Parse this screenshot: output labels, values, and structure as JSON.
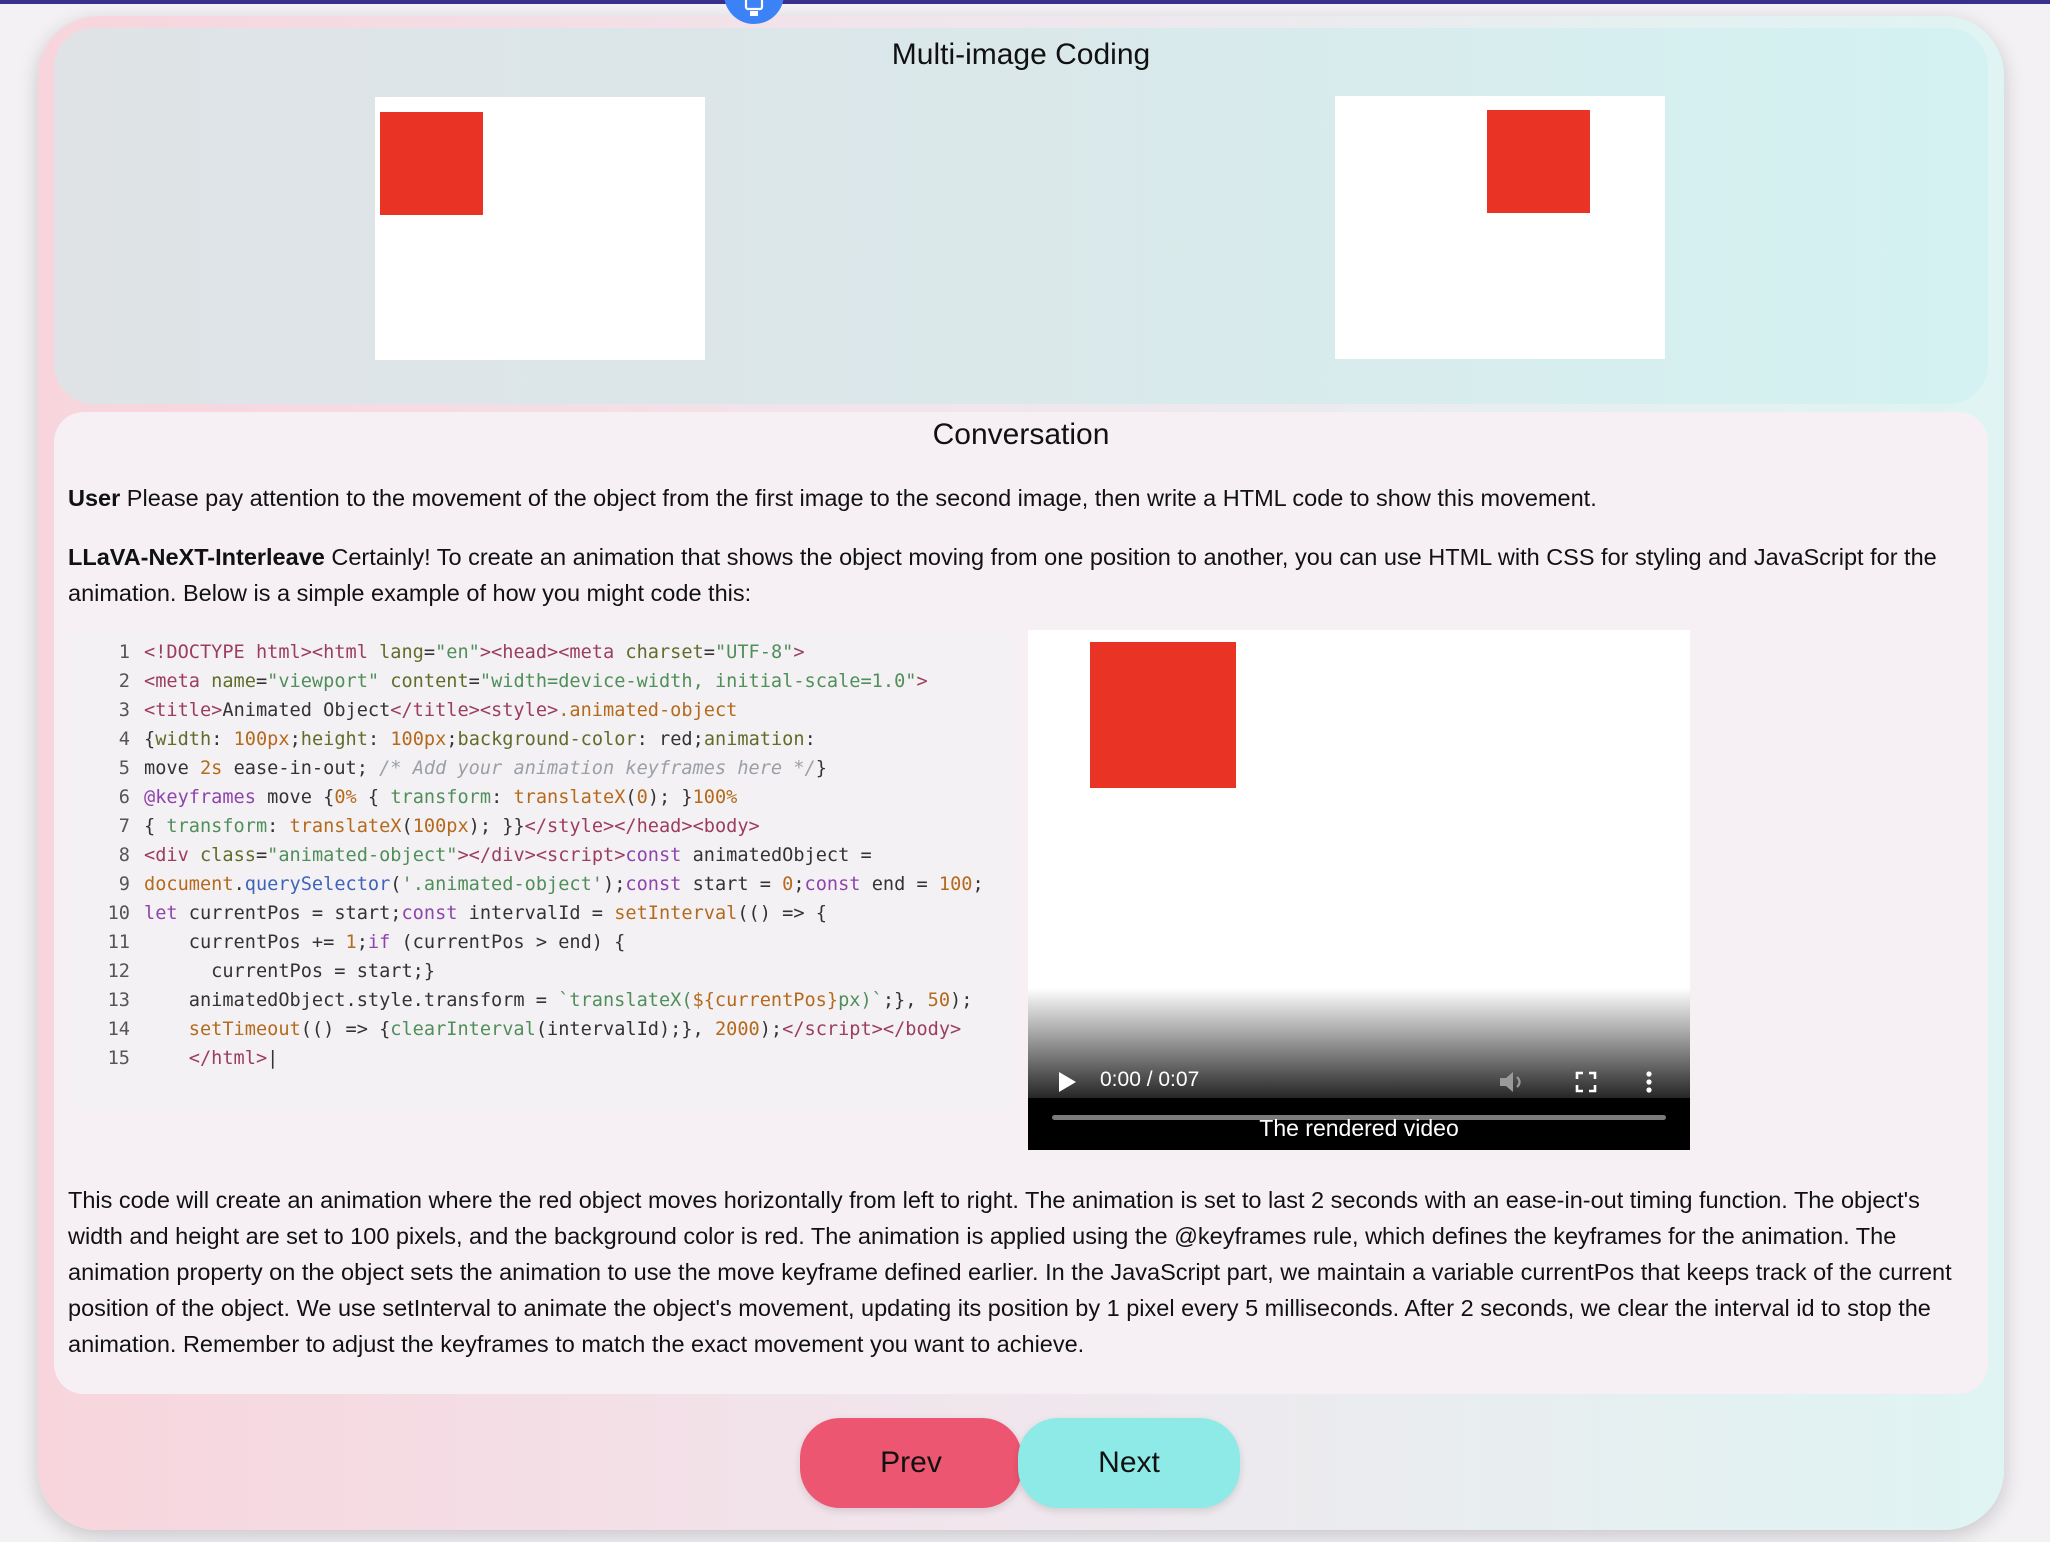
{
  "top_panel": {
    "title": "Multi-image Coding"
  },
  "conversation": {
    "title": "Conversation",
    "user_label": "User",
    "user_text": "Please pay attention to the movement of the object from the first image to the second image, then write a HTML code to show this movement.",
    "assistant_label": "LLaVA-NeXT-Interleave",
    "assistant_text": "Certainly! To create an animation that shows the object moving from one position to another, you can use HTML with CSS for styling and JavaScript for the animation. Below is a simple example of how you might code this:",
    "summary_text": "This code will create an animation where the red object moves horizontally from left to right. The animation is set to last 2 seconds with an ease-in-out timing function. The object's width and height are set to 100 pixels, and the background color is red. The animation is applied using the @keyframes rule, which defines the keyframes for the animation. The animation property on the object sets the animation to use the move keyframe defined earlier. In the JavaScript part, we maintain a variable currentPos that keeps track of the current position of the object. We use setInterval to animate the object's movement, updating its position by 1 pixel every 5 milliseconds. After 2 seconds, we clear the interval id to stop the animation. Remember to adjust the keyframes to match the exact movement you want to achieve."
  },
  "code": {
    "line_numbers": [
      "1",
      "2",
      "3",
      "4",
      "5",
      "6",
      "7",
      "8",
      "9",
      "10",
      "11",
      "12",
      "13",
      "14",
      "15"
    ]
  },
  "video": {
    "time": "0:00 / 0:07",
    "caption": "The rendered video"
  },
  "nav": {
    "prev_label": "Prev",
    "next_label": "Next"
  },
  "colors": {
    "accent_red": "#e93324",
    "prev_button": "#ec5670",
    "next_button": "#8deae6",
    "topbar": "#3a2f8f",
    "float_button": "#3b82f6"
  },
  "icons": [
    "robot-icon",
    "play-icon",
    "mute-icon",
    "fullscreen-icon",
    "more-options-icon"
  ]
}
